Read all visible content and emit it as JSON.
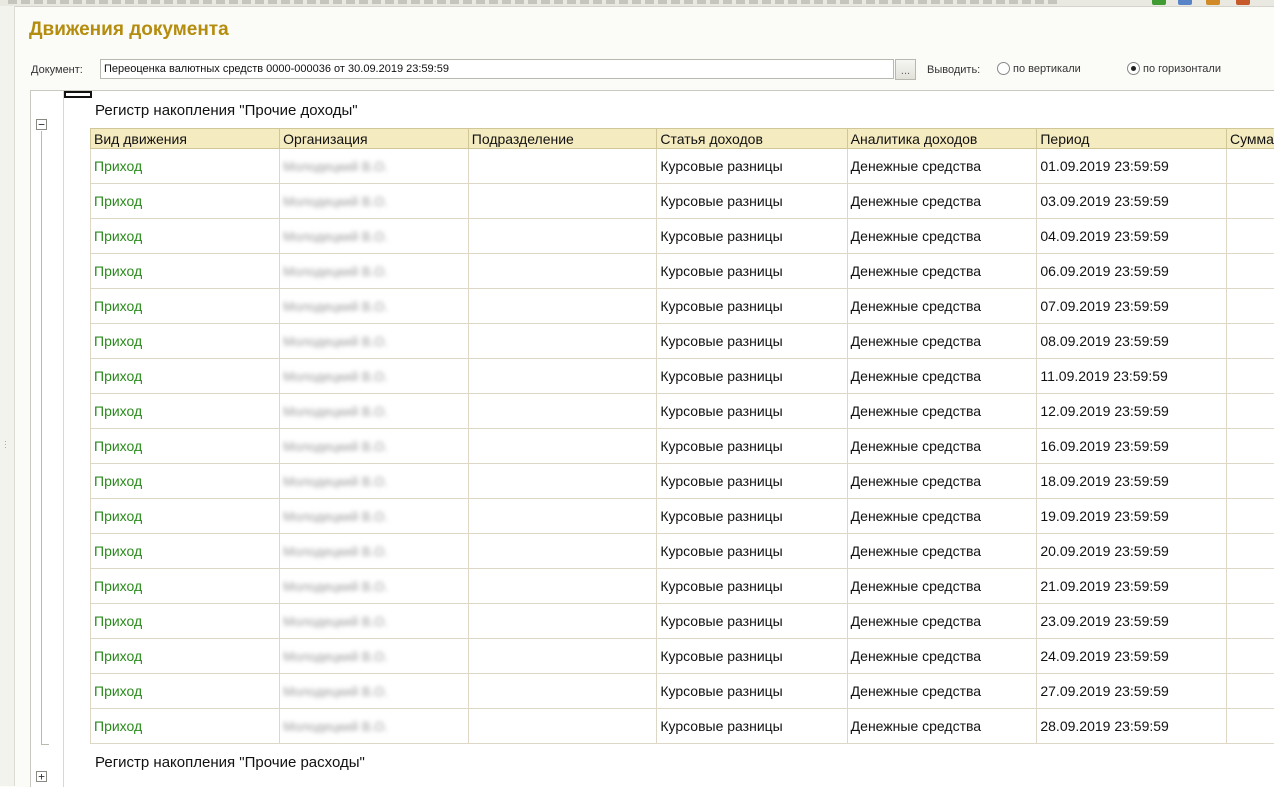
{
  "page": {
    "title": "Движения документа"
  },
  "document": {
    "label": "Документ:",
    "value": "Переоценка валютных средств 0000-000036 от 30.09.2019 23:59:59",
    "select_glyph": "..."
  },
  "output": {
    "label": "Выводить:",
    "options": [
      {
        "label": "по вертикали",
        "selected": false
      },
      {
        "label": "по горизонтали",
        "selected": true
      }
    ]
  },
  "registers": [
    {
      "title": "Регистр накопления \"Прочие доходы\"",
      "expanded": true,
      "columns": [
        "Вид движения",
        "Организация",
        "Подразделение",
        "Статья доходов",
        "Аналитика доходов",
        "Период",
        "Сумма"
      ],
      "rows": [
        {
          "kind": "Приход",
          "org": "Молодецкий В.О.",
          "division": "",
          "article": "Курсовые разницы",
          "analytics": "Денежные средства",
          "period": "01.09.2019 23:59:59"
        },
        {
          "kind": "Приход",
          "org": "Молодецкий В.О.",
          "division": "",
          "article": "Курсовые разницы",
          "analytics": "Денежные средства",
          "period": "03.09.2019 23:59:59"
        },
        {
          "kind": "Приход",
          "org": "Молодецкий В.О.",
          "division": "",
          "article": "Курсовые разницы",
          "analytics": "Денежные средства",
          "period": "04.09.2019 23:59:59"
        },
        {
          "kind": "Приход",
          "org": "Молодецкий В.О.",
          "division": "",
          "article": "Курсовые разницы",
          "analytics": "Денежные средства",
          "period": "06.09.2019 23:59:59"
        },
        {
          "kind": "Приход",
          "org": "Молодецкий В.О.",
          "division": "",
          "article": "Курсовые разницы",
          "analytics": "Денежные средства",
          "period": "07.09.2019 23:59:59"
        },
        {
          "kind": "Приход",
          "org": "Молодецкий В.О.",
          "division": "",
          "article": "Курсовые разницы",
          "analytics": "Денежные средства",
          "period": "08.09.2019 23:59:59"
        },
        {
          "kind": "Приход",
          "org": "Молодецкий В.О.",
          "division": "",
          "article": "Курсовые разницы",
          "analytics": "Денежные средства",
          "period": "11.09.2019 23:59:59"
        },
        {
          "kind": "Приход",
          "org": "Молодецкий В.О.",
          "division": "",
          "article": "Курсовые разницы",
          "analytics": "Денежные средства",
          "period": "12.09.2019 23:59:59"
        },
        {
          "kind": "Приход",
          "org": "Молодецкий В.О.",
          "division": "",
          "article": "Курсовые разницы",
          "analytics": "Денежные средства",
          "period": "16.09.2019 23:59:59"
        },
        {
          "kind": "Приход",
          "org": "Молодецкий В.О.",
          "division": "",
          "article": "Курсовые разницы",
          "analytics": "Денежные средства",
          "period": "18.09.2019 23:59:59"
        },
        {
          "kind": "Приход",
          "org": "Молодецкий В.О.",
          "division": "",
          "article": "Курсовые разницы",
          "analytics": "Денежные средства",
          "period": "19.09.2019 23:59:59"
        },
        {
          "kind": "Приход",
          "org": "Молодецкий В.О.",
          "division": "",
          "article": "Курсовые разницы",
          "analytics": "Денежные средства",
          "period": "20.09.2019 23:59:59"
        },
        {
          "kind": "Приход",
          "org": "Молодецкий В.О.",
          "division": "",
          "article": "Курсовые разницы",
          "analytics": "Денежные средства",
          "period": "21.09.2019 23:59:59"
        },
        {
          "kind": "Приход",
          "org": "Молодецкий В.О.",
          "division": "",
          "article": "Курсовые разницы",
          "analytics": "Денежные средства",
          "period": "23.09.2019 23:59:59"
        },
        {
          "kind": "Приход",
          "org": "Молодецкий В.О.",
          "division": "",
          "article": "Курсовые разницы",
          "analytics": "Денежные средства",
          "period": "24.09.2019 23:59:59"
        },
        {
          "kind": "Приход",
          "org": "Молодецкий В.О.",
          "division": "",
          "article": "Курсовые разницы",
          "analytics": "Денежные средства",
          "period": "27.09.2019 23:59:59"
        },
        {
          "kind": "Приход",
          "org": "Молодецкий В.О.",
          "division": "",
          "article": "Курсовые разницы",
          "analytics": "Денежные средства",
          "period": "28.09.2019 23:59:59"
        }
      ]
    },
    {
      "title": "Регистр накопления \"Прочие расходы\"",
      "expanded": false
    }
  ],
  "colors": {
    "title": "#b58d0e",
    "header_bg": "#f5ebc0",
    "movement_kind": "#2a8a1c"
  }
}
